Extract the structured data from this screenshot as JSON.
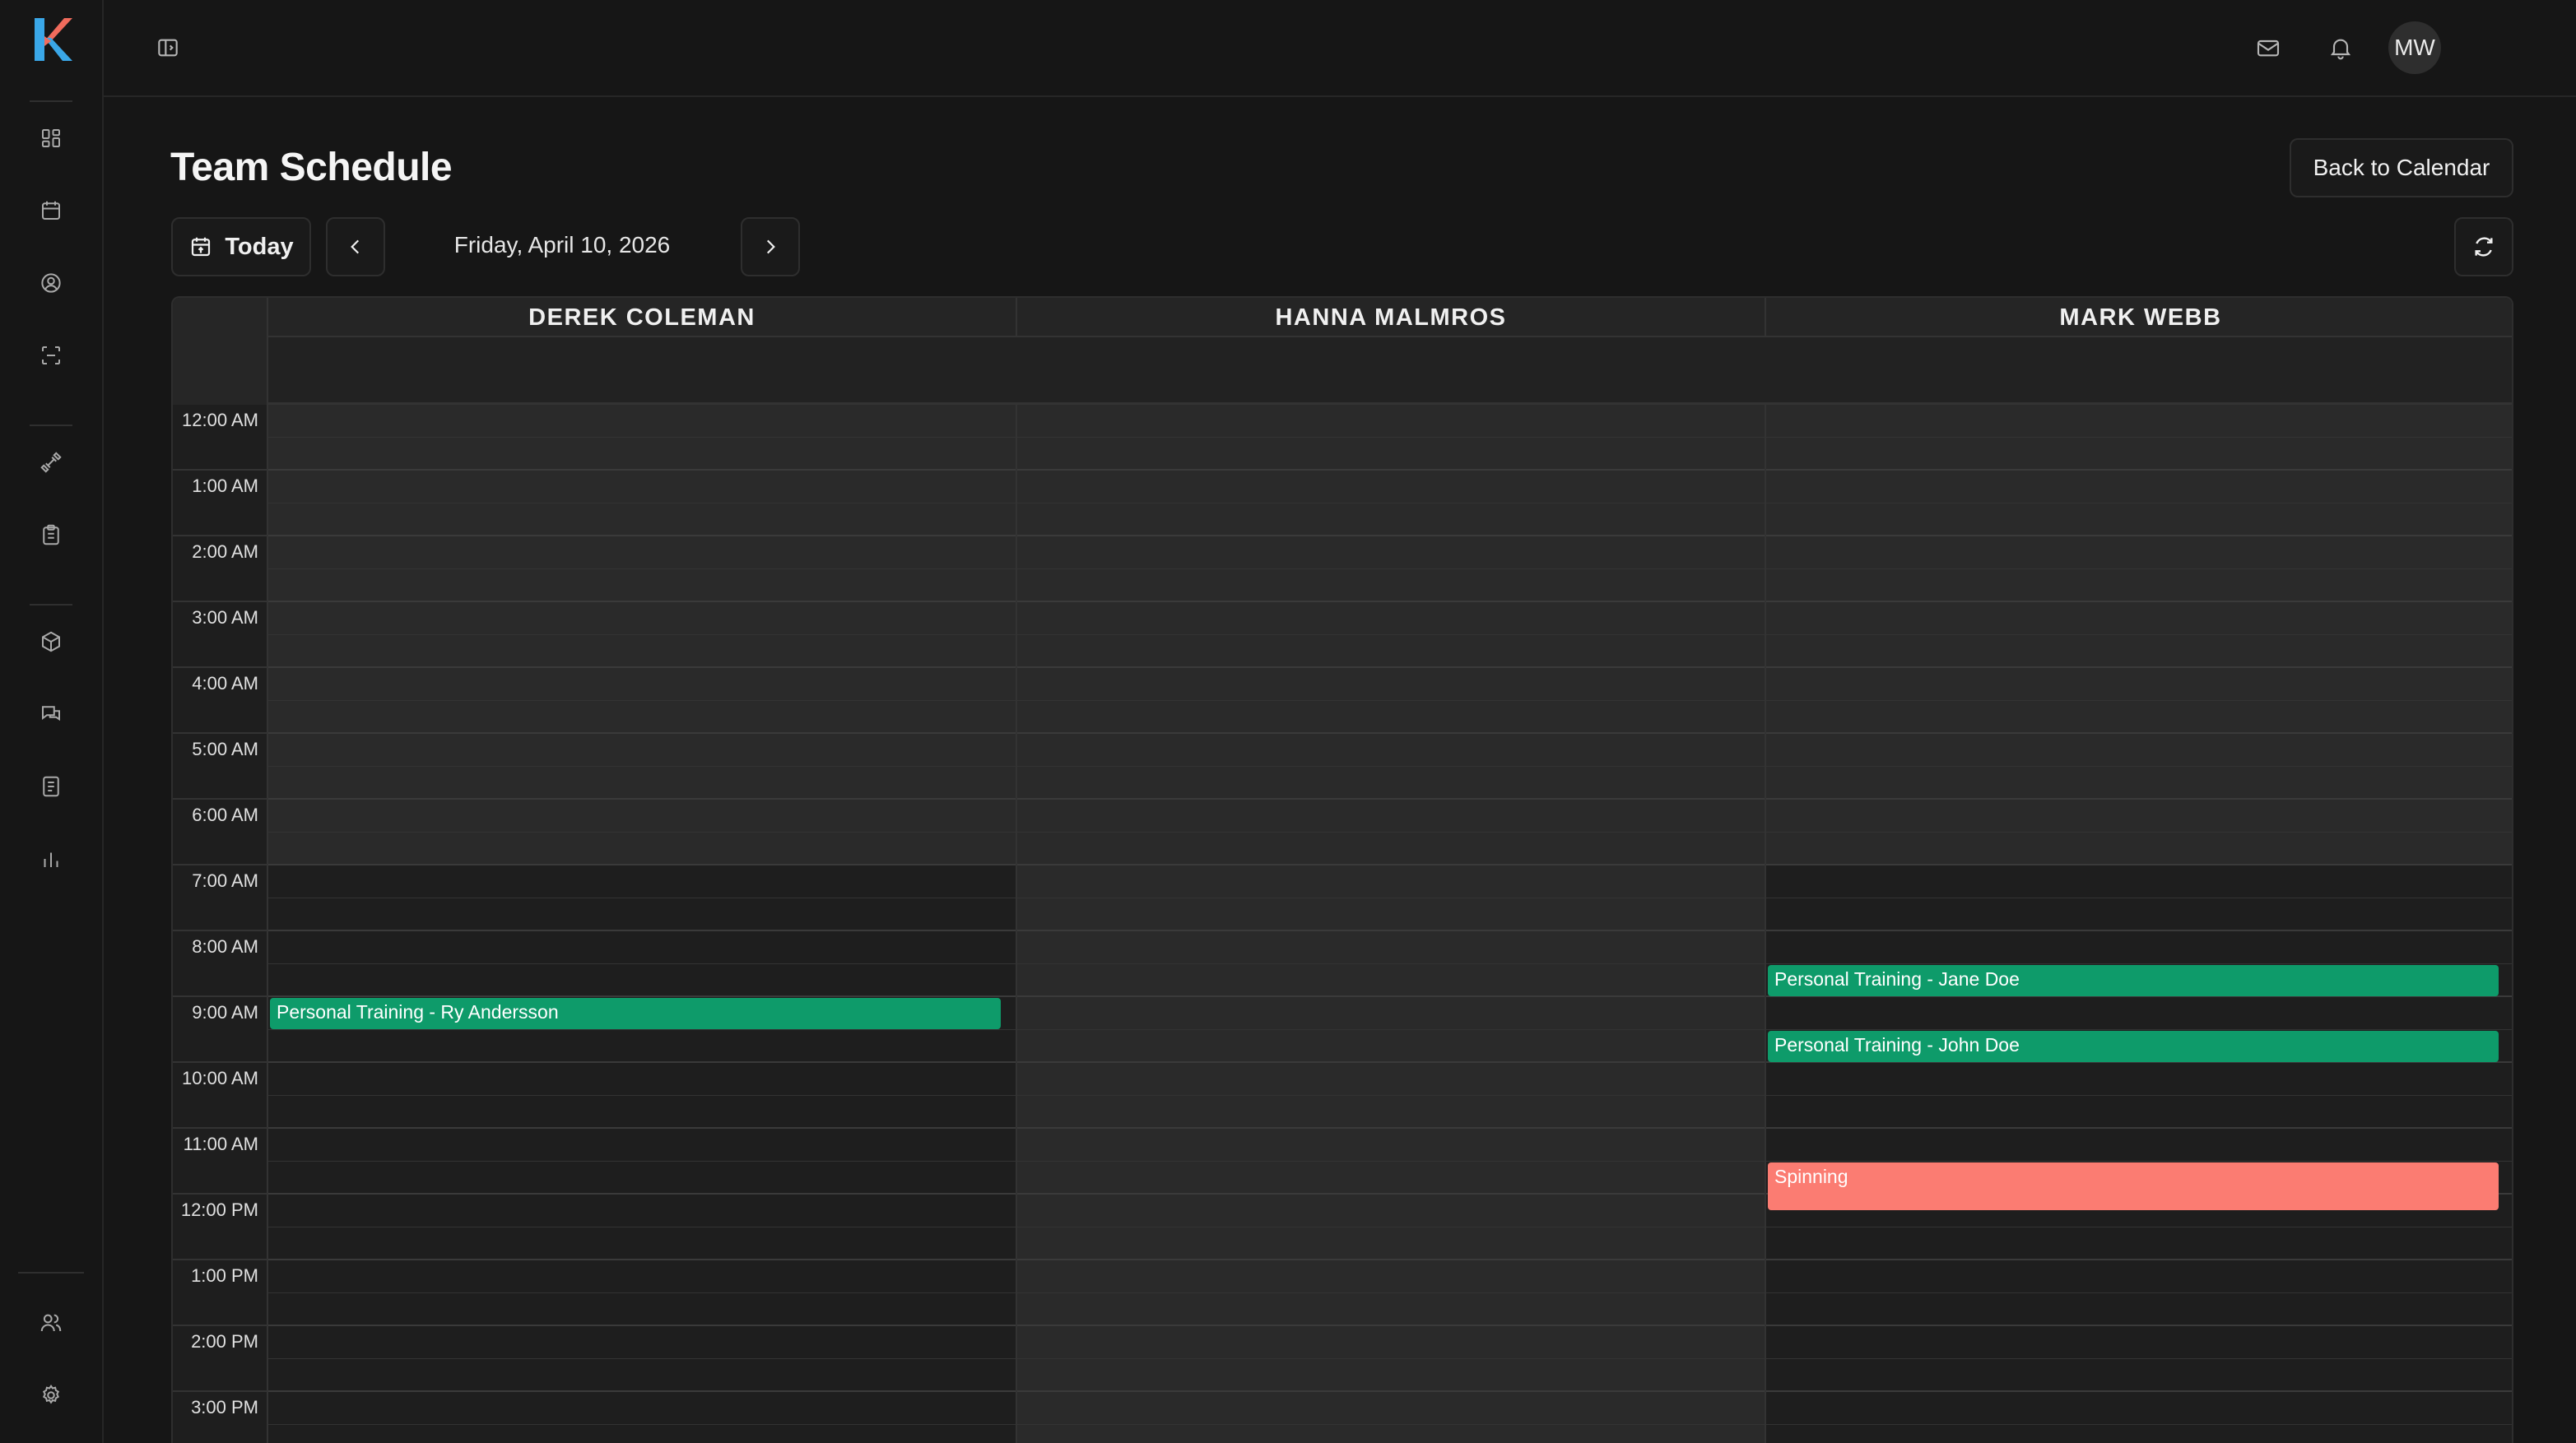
{
  "app": {
    "logo": "K"
  },
  "sidebar": {
    "items": [
      {
        "icon": "dashboard-icon"
      },
      {
        "icon": "calendar-icon"
      },
      {
        "icon": "user-circle-icon"
      },
      {
        "icon": "scan-icon"
      },
      {
        "icon": "dumbbell-icon"
      },
      {
        "icon": "clipboard-icon"
      },
      {
        "icon": "box-icon"
      },
      {
        "icon": "messages-icon"
      },
      {
        "icon": "document-icon"
      },
      {
        "icon": "bar-chart-icon"
      }
    ],
    "bottom": [
      {
        "icon": "users-icon"
      },
      {
        "icon": "settings-icon"
      }
    ]
  },
  "topbar": {
    "toggle_icon": "sidebar-toggle-icon",
    "icons": [
      "mail-icon",
      "bell-icon",
      "moon-icon"
    ],
    "avatar": "MW"
  },
  "page": {
    "title": "Team Schedule",
    "back_label": "Back to Calendar",
    "today_label": "Today",
    "date": "Friday, April 10, 2026"
  },
  "calendar": {
    "resources": [
      "DEREK COLEMAN",
      "HANNA MALMROS",
      "MARK WEBB"
    ],
    "time_labels": [
      "12:00 AM",
      "1:00 AM",
      "2:00 AM",
      "3:00 AM",
      "4:00 AM",
      "5:00 AM",
      "6:00 AM",
      "7:00 AM",
      "8:00 AM",
      "9:00 AM",
      "10:00 AM",
      "11:00 AM",
      "12:00 PM",
      "1:00 PM",
      "2:00 PM",
      "3:00 PM"
    ],
    "events": [
      {
        "title": "Personal Training - Ry Andersson",
        "resource": 0,
        "start": 9.0,
        "end": 9.5,
        "color": "#0e9b6a"
      },
      {
        "title": "Personal Training - Jane Doe",
        "resource": 2,
        "start": 8.5,
        "end": 9.0,
        "color": "#0e9b6a"
      },
      {
        "title": "Personal Training - John Doe",
        "resource": 2,
        "start": 9.5,
        "end": 10.0,
        "color": "#0e9b6a"
      },
      {
        "title": "Spinning",
        "resource": 2,
        "start": 11.5,
        "end": 12.25,
        "color": "#fb7c72"
      }
    ],
    "colors": {
      "available": "#1e1e1e",
      "unavailable": "#2a2a2a",
      "event_green": "#0e9b6a",
      "event_salmon": "#fb7c72"
    }
  }
}
